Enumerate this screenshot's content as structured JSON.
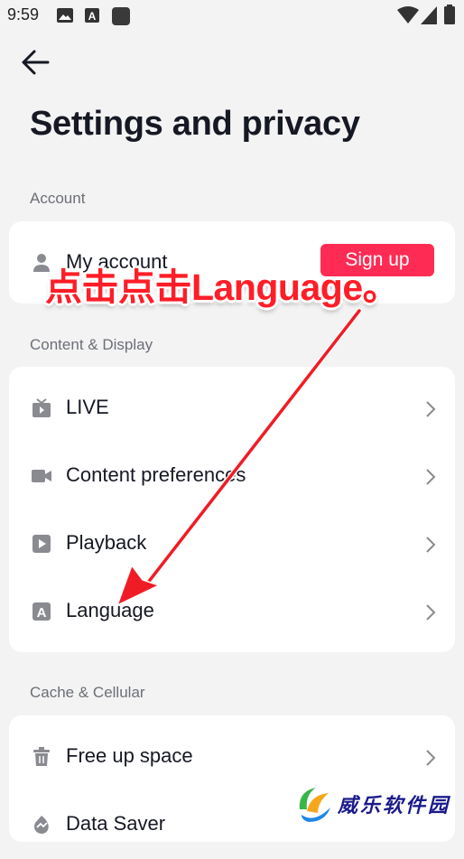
{
  "status_bar": {
    "time": "9:59"
  },
  "header": {
    "title": "Settings and privacy"
  },
  "sections": {
    "account": {
      "label": "Account",
      "items": [
        {
          "label": "My account",
          "icon": "person-icon"
        }
      ],
      "signup_label": "Sign up"
    },
    "content": {
      "label": "Content & Display",
      "items": [
        {
          "label": "LIVE",
          "icon": "live-tv-icon"
        },
        {
          "label": "Content preferences",
          "icon": "video-camera-icon"
        },
        {
          "label": "Playback",
          "icon": "play-icon"
        },
        {
          "label": "Language",
          "icon": "language-icon"
        }
      ]
    },
    "cache": {
      "label": "Cache & Cellular",
      "items": [
        {
          "label": "Free up space",
          "icon": "trash-icon"
        },
        {
          "label": "Data Saver",
          "icon": "data-saver-icon"
        }
      ]
    }
  },
  "annotation": {
    "text": "点击点击Language。"
  },
  "watermark": {
    "text": "威乐软件园"
  },
  "colors": {
    "accent": "#fe2c55",
    "annotation": "#ff1d27",
    "background": "#f3f3f4"
  }
}
